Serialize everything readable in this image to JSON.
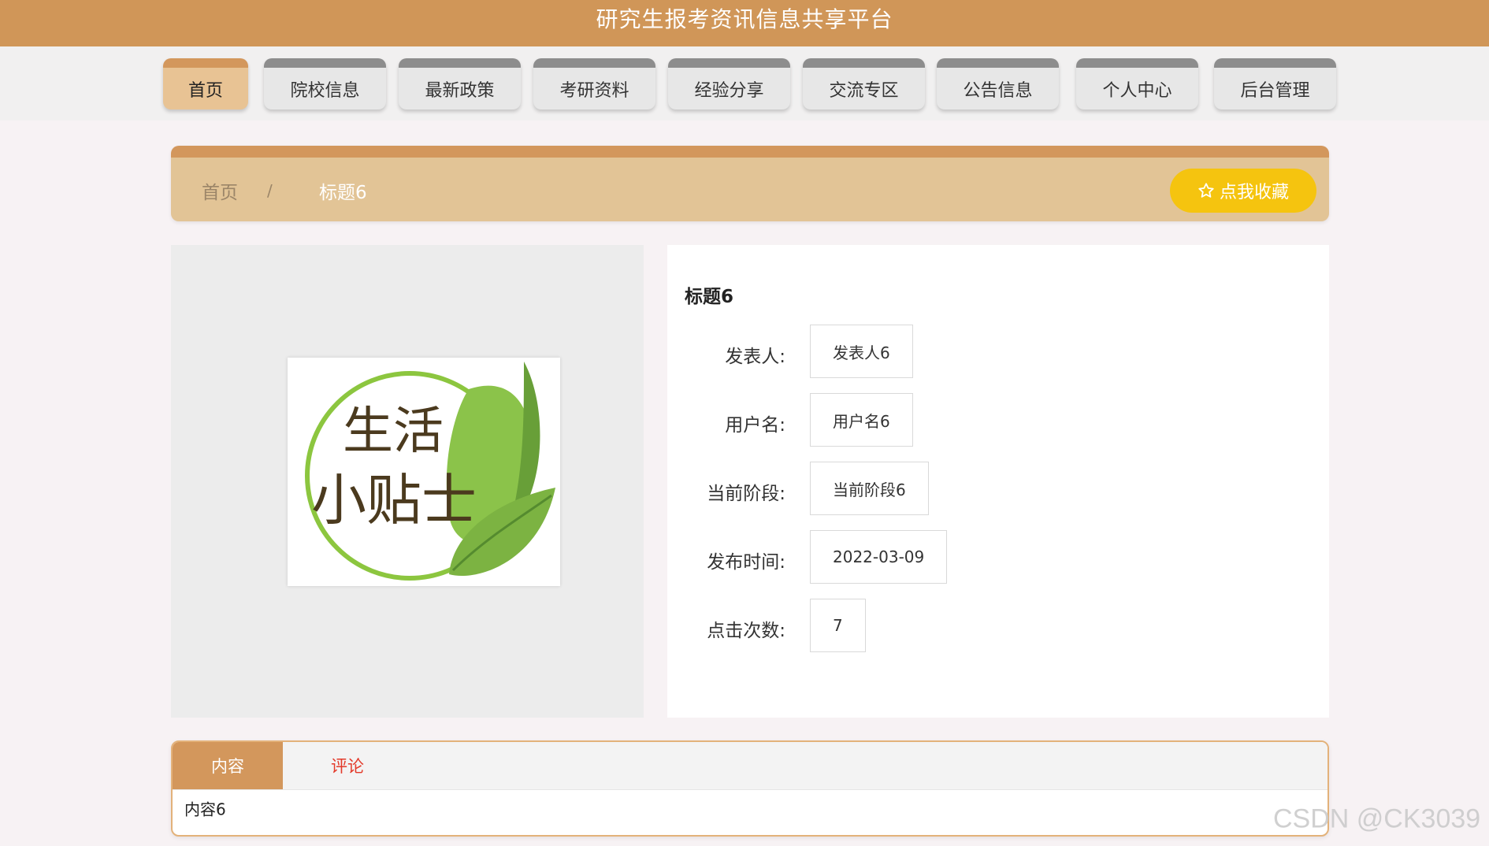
{
  "header": {
    "site_title": "研究生报考资讯信息共享平台"
  },
  "nav": {
    "items": [
      {
        "label": "首页",
        "active": true
      },
      {
        "label": "院校信息"
      },
      {
        "label": "最新政策"
      },
      {
        "label": "考研资料"
      },
      {
        "label": "经验分享"
      },
      {
        "label": "交流专区"
      },
      {
        "label": "公告信息"
      },
      {
        "label": "个人中心"
      },
      {
        "label": "后台管理"
      }
    ]
  },
  "breadcrumb": {
    "home": "首页",
    "separator": "/",
    "current": "标题6"
  },
  "favorite_button": {
    "icon": "star-icon",
    "label": "点我收藏"
  },
  "image": {
    "line1": "生活",
    "line2": "小贴士"
  },
  "detail": {
    "title": "标题6",
    "fields": [
      {
        "label": "发表人:",
        "value": "发表人6"
      },
      {
        "label": "用户名:",
        "value": "用户名6"
      },
      {
        "label": "当前阶段:",
        "value": "当前阶段6"
      },
      {
        "label": "发布时间:",
        "value": "2022-03-09"
      },
      {
        "label": "点击次数:",
        "value": "7"
      }
    ]
  },
  "tabs": {
    "items": [
      {
        "label": "内容",
        "active": true
      },
      {
        "label": "评论"
      }
    ],
    "content": "内容6"
  },
  "watermark": "CSDN @CK3039",
  "colors": {
    "brand": "#d09658",
    "accent_yellow": "#f5c40f",
    "comment_tab": "#e33a2a",
    "leaf_green": "#7cb342"
  }
}
